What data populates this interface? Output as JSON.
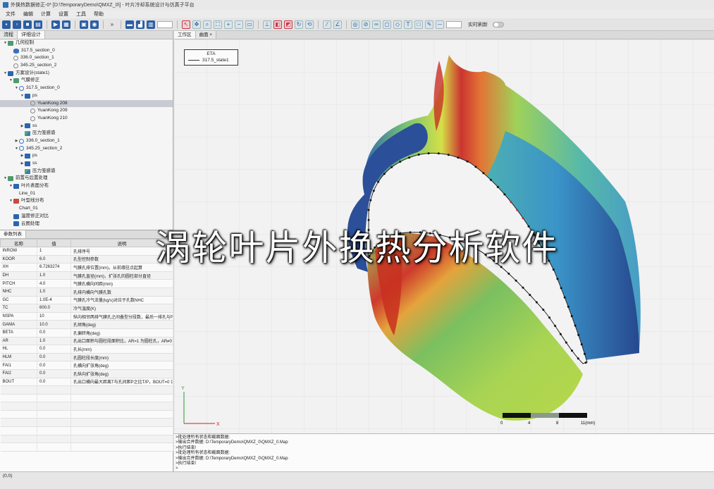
{
  "window": {
    "title": "外换热数据修正-0* [D:\\TemporaryDemo\\QMXZ_0\\] - 叶片冷却系统设计与仿真子平台"
  },
  "menu": [
    "文件",
    "编辑",
    "计算",
    "设置",
    "工具",
    "帮助"
  ],
  "toolbar": {
    "realtime_label": "实时刷新"
  },
  "left_tabs": [
    "流程",
    "详细设计"
  ],
  "tree": [
    {
      "indent": 0,
      "arrow": "▼",
      "icon": "ic-green",
      "label": "几何控制",
      "hl": false
    },
    {
      "indent": 1,
      "arrow": "",
      "icon": "ic-eye",
      "label": "317.5_section_0",
      "hl": false
    },
    {
      "indent": 1,
      "arrow": "",
      "icon": "ic-grayring",
      "label": "336.0_section_1",
      "hl": false
    },
    {
      "indent": 1,
      "arrow": "",
      "icon": "ic-grayring",
      "label": "345.25_section_2",
      "hl": false
    },
    {
      "indent": 0,
      "arrow": "▼",
      "icon": "ic-blue",
      "label": "方案设计(state1)",
      "hl": false
    },
    {
      "indent": 1,
      "arrow": "▼",
      "icon": "ic-green",
      "label": "气膜修正",
      "hl": false
    },
    {
      "indent": 2,
      "arrow": "▼",
      "icon": "ic-ring",
      "label": "317.5_section_0",
      "hl": false
    },
    {
      "indent": 3,
      "arrow": "▼",
      "icon": "ic-blue",
      "label": "ps",
      "hl": false
    },
    {
      "indent": 4,
      "arrow": "",
      "icon": "ic-grayring",
      "label": "YuanKong   208",
      "hl": true
    },
    {
      "indent": 4,
      "arrow": "",
      "icon": "ic-grayring",
      "label": "YuanKong   209",
      "hl": false
    },
    {
      "indent": 4,
      "arrow": "",
      "icon": "ic-grayring",
      "label": "YuanKong   210",
      "hl": false
    },
    {
      "indent": 3,
      "arrow": "▶",
      "icon": "ic-blue",
      "label": "ss",
      "hl": false
    },
    {
      "indent": 3,
      "arrow": "",
      "icon": "ic-chart",
      "label": "压力笼感谱",
      "hl": false
    },
    {
      "indent": 2,
      "arrow": "▶",
      "icon": "ic-ring",
      "label": "336.0_section_1",
      "hl": false
    },
    {
      "indent": 2,
      "arrow": "▼",
      "icon": "ic-ring",
      "label": "345.25_section_2",
      "hl": false
    },
    {
      "indent": 3,
      "arrow": "▶",
      "icon": "ic-blue",
      "label": "ps",
      "hl": false
    },
    {
      "indent": 3,
      "arrow": "▶",
      "icon": "ic-blue",
      "label": "ss",
      "hl": false
    },
    {
      "indent": 3,
      "arrow": "",
      "icon": "ic-chart",
      "label": "压力笼感谱",
      "hl": false
    },
    {
      "indent": 0,
      "arrow": "▼",
      "icon": "ic-green",
      "label": "前置与后置处理",
      "hl": false
    },
    {
      "indent": 1,
      "arrow": "▼",
      "icon": "ic-blue",
      "label": "叶片表面分布",
      "hl": false
    },
    {
      "indent": 2,
      "arrow": "",
      "icon": "",
      "label": "Line_01",
      "hl": false
    },
    {
      "indent": 1,
      "arrow": "▼",
      "icon": "ic-red",
      "label": "叶型线分布",
      "hl": false
    },
    {
      "indent": 2,
      "arrow": "",
      "icon": "",
      "label": "Chart_01",
      "hl": false
    },
    {
      "indent": 1,
      "arrow": "",
      "icon": "ic-blue",
      "label": "温度修正对比",
      "hl": false
    },
    {
      "indent": 1,
      "arrow": "",
      "icon": "ic-blue",
      "label": "云图处理",
      "hl": false
    }
  ],
  "params": {
    "tab_label": "参数列表",
    "headers": [
      "名称",
      "值",
      "说明"
    ],
    "rows": [
      [
        "INROW",
        "1",
        "孔排序号"
      ],
      [
        "KOOR",
        "6.0",
        "孔型控制参数"
      ],
      [
        "XH",
        "6.7263274",
        "气膜孔排位置(mm)，从前缘驻点起算"
      ],
      [
        "DH",
        "1.0",
        "气膜孔直径(mm)，扩张孔的圆柱部分直径"
      ],
      [
        "PITCH",
        "4.0",
        "气膜孔横向间距(mm)"
      ],
      [
        "NHC",
        "1.0",
        "孔排内横向气膜孔数"
      ],
      [
        "GC",
        "1.0E-4",
        "气膜孔冷气流量(kg/s)对应于孔数NHC"
      ],
      [
        "TC",
        "600.0",
        "冷气温度(K)"
      ],
      [
        "NSPA",
        "10",
        "纵向相邻两排气膜孔之间叠型分段数，最后一排孔与叶"
      ],
      [
        "GAMA",
        "10.0",
        "孔倾角(deg)"
      ],
      [
        "BETA",
        "0.0",
        "孔偏转角(deg)"
      ],
      [
        "AR",
        "1.0",
        "孔出口面积与圆柱段面积比，AR=1 为圆柱孔，AR≠0"
      ],
      [
        "HL",
        "0.0",
        "孔长(mm)"
      ],
      [
        "HLM",
        "0.0",
        "孔圆柱段长度(mm)"
      ],
      [
        "FAI1",
        "0.0",
        "孔横向扩张角(deg)"
      ],
      [
        "FAI2",
        "0.0",
        "孔纵向扩张角(deg)"
      ],
      [
        "BOUT",
        "0.0",
        "孔出口横向最大距离T与孔间距P之比T/P，BOUT=0 计"
      ],
      [
        "",
        "",
        ""
      ],
      [
        "",
        "",
        ""
      ],
      [
        "",
        "",
        ""
      ],
      [
        "",
        "",
        ""
      ],
      [
        "",
        "",
        ""
      ],
      [
        "",
        "",
        ""
      ],
      [
        "",
        "",
        ""
      ],
      [
        "",
        "",
        ""
      ]
    ]
  },
  "view_tabs": [
    "工作区",
    "曲面 ×"
  ],
  "legend": {
    "title": "ETA",
    "entry": "317.5_state1"
  },
  "axes": {
    "y": "Y",
    "x": "X"
  },
  "scalebar": {
    "labels": [
      "0",
      "4",
      "8",
      "11(mm)"
    ]
  },
  "overlay_title": "涡轮叶片外换热分析软件",
  "console": [
    ">批处理所有状态和截面数据:",
    ">输出合并数据: D:\\TemporaryDemo\\QMXZ_0\\QMXZ_0.Map",
    ">执行结束!",
    ">批处理所有状态和截面数据:",
    ">输出合并数据: D:\\TemporaryDemo\\QMXZ_0\\QMXZ_0.Map",
    ">执行结束!",
    ">"
  ],
  "status": {
    "coords": "(0,0)"
  }
}
